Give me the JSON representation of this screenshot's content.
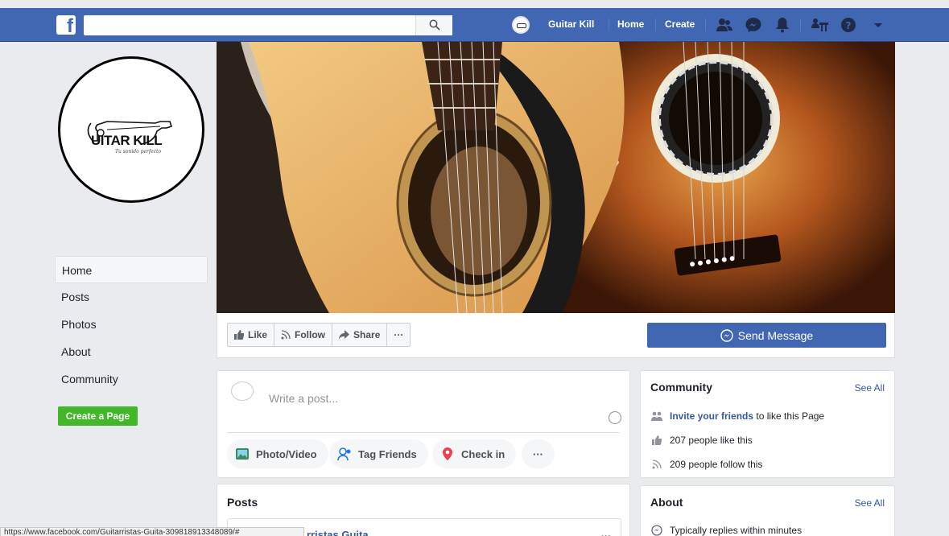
{
  "topbar": {
    "search_placeholder": "",
    "page_name": "Guitar Kill",
    "home_label": "Home",
    "create_label": "Create",
    "icons": [
      "search-icon",
      "friends-icon",
      "messenger-icon",
      "bell-icon",
      "page-users-icon",
      "help-icon",
      "dropdown-icon"
    ],
    "brand_color": "#4267b2"
  },
  "profile": {
    "logo_text": "UITAR KILL",
    "logo_tagline": "Tu sonido perfecto"
  },
  "left_nav": {
    "items": [
      {
        "label": "Home",
        "active": true
      },
      {
        "label": "Posts"
      },
      {
        "label": "Photos"
      },
      {
        "label": "About"
      },
      {
        "label": "Community"
      }
    ],
    "create_page_label": "Create a Page"
  },
  "actions": {
    "like_label": "Like",
    "follow_label": "Follow",
    "share_label": "Share",
    "more_label": "···",
    "send_message_label": "Send Message"
  },
  "composer": {
    "placeholder": "Write a post...",
    "photo_video_label": "Photo/Video",
    "tag_friends_label": "Tag Friends",
    "check_in_label": "Check in",
    "more_label": "···"
  },
  "posts": {
    "title": "Posts",
    "more_label": "···"
  },
  "community": {
    "title": "Community",
    "see_all": "See All",
    "invite_link": "Invite your friends",
    "invite_rest": "to like this Page",
    "likes_text": "207 people like this",
    "follows_text": "209 people follow this"
  },
  "about": {
    "title": "About",
    "see_all": "See All",
    "reply_text": "Typically replies within minutes"
  },
  "status_bar": {
    "url": "https://www.facebook.com/Guitarristas-Guita-309818913348089/#",
    "peek_text": "rristas Guita"
  }
}
